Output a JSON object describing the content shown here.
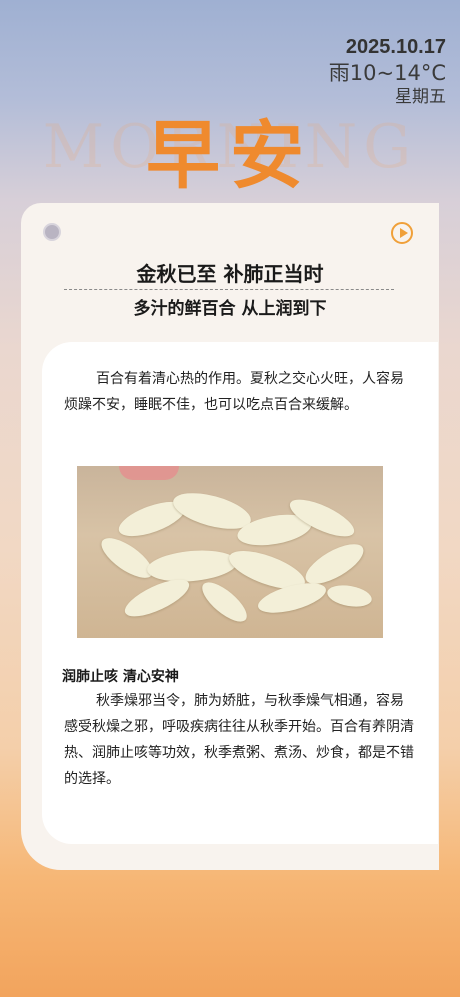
{
  "header": {
    "date": "2025.10.17",
    "weather": "雨10~14°C",
    "weekday": "星期五"
  },
  "greeting": "早安",
  "background_word": "MORNING",
  "card": {
    "headline": "金秋已至  补肺正当时",
    "subhead": "多汁的鲜百合 从上润到下",
    "play_icon": "play-circle-icon",
    "paragraph1": "百合有着清心热的作用。夏秋之交心火旺，人容易烦躁不安，睡眠不佳，也可以吃点百合来缓解。",
    "section_title": "润肺止咳 清心安神",
    "paragraph2": "秋季燥邪当令，肺为娇脏，与秋季燥气相通，容易感受秋燥之邪，呼吸疾病往往从秋季开始。百合有养阴清热、润肺止咳等功效，秋季煮粥、煮汤、炒食，都是不错的选择。"
  },
  "colors": {
    "accent": "#ef8a2e",
    "play": "#f0a03a",
    "card_bg": "#f8f3ee"
  }
}
